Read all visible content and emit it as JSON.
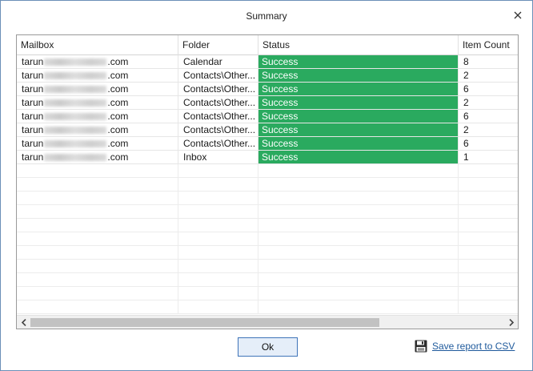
{
  "dialog": {
    "title": "Summary"
  },
  "grid": {
    "columns": [
      "Mailbox",
      "Folder",
      "Status",
      "Item Count"
    ],
    "rows": [
      {
        "mailbox_prefix": "tarun",
        "mailbox_suffix": ".com",
        "folder": "Calendar",
        "status": "Success",
        "count": "8"
      },
      {
        "mailbox_prefix": "tarun",
        "mailbox_suffix": ".com",
        "folder": "Contacts\\Other...",
        "status": "Success",
        "count": "2"
      },
      {
        "mailbox_prefix": "tarun",
        "mailbox_suffix": ".com",
        "folder": "Contacts\\Other...",
        "status": "Success",
        "count": "6"
      },
      {
        "mailbox_prefix": "tarun",
        "mailbox_suffix": ".com",
        "folder": "Contacts\\Other...",
        "status": "Success",
        "count": "2"
      },
      {
        "mailbox_prefix": "tarun",
        "mailbox_suffix": ".com",
        "folder": "Contacts\\Other...",
        "status": "Success",
        "count": "6"
      },
      {
        "mailbox_prefix": "tarun",
        "mailbox_suffix": ".com",
        "folder": "Contacts\\Other...",
        "status": "Success",
        "count": "2"
      },
      {
        "mailbox_prefix": "tarun",
        "mailbox_suffix": ".com",
        "folder": "Contacts\\Other...",
        "status": "Success",
        "count": "6"
      },
      {
        "mailbox_prefix": "tarun",
        "mailbox_suffix": ".com",
        "folder": "Inbox",
        "status": "Success",
        "count": "1"
      }
    ]
  },
  "buttons": {
    "ok_label": "Ok",
    "save_label": "Save report to CSV"
  },
  "colors": {
    "success": "#2aaa5f",
    "link": "#1f5a9c",
    "ok_border": "#3f74b9"
  },
  "icons": {
    "close": "close-icon",
    "save": "floppy-disk-icon",
    "scroll_left": "chevron-left-icon",
    "scroll_right": "chevron-right-icon"
  }
}
